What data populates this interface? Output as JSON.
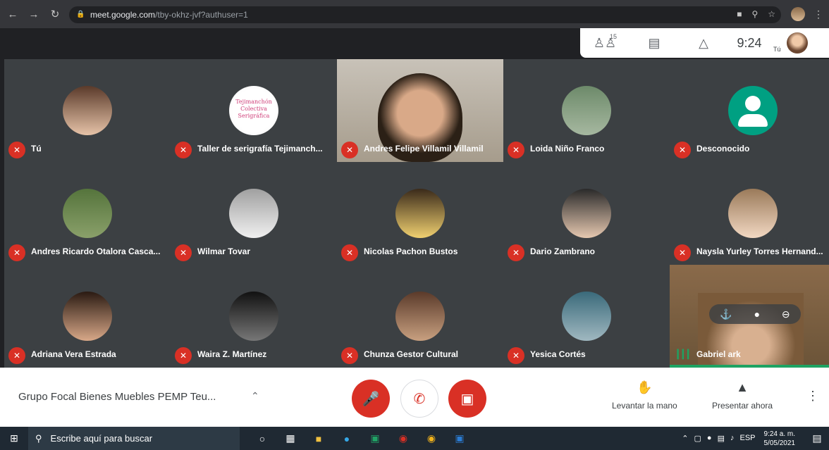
{
  "browser": {
    "url_host": "meet.google.com",
    "url_path": "/tby-okhz-jvf?authuser=1"
  },
  "meet_panel": {
    "participants_count": "15",
    "time": "9:24",
    "you_label": "Tú"
  },
  "tiles": [
    {
      "name": "Tú",
      "face": "linear-gradient(#5a3a2a,#e6c3a8)"
    },
    {
      "name": "Taller de serigrafía Tejimanch...",
      "face": "radial-gradient(circle,#ffffff 60%,#f2f2f2)",
      "logo_text": "Tejimanchón Colectiva Serigráfica"
    },
    {
      "name": "Andres Felipe Villamil Villamil",
      "face": "",
      "video": true
    },
    {
      "name": "Loida Niño Franco",
      "face": "linear-gradient(#6d8a6a,#a6b8a0)"
    },
    {
      "name": "Desconocido",
      "face": "#00a082",
      "generic": true
    },
    {
      "name": "Andres Ricardo Otalora Casca...",
      "face": "linear-gradient(#55743c,#8aa06a)"
    },
    {
      "name": "Wilmar Tovar",
      "face": "linear-gradient(#a0a0a0,#f0f0f0)"
    },
    {
      "name": "Nicolas Pachon Bustos",
      "face": "linear-gradient(#3a2a1a,#f0d070)"
    },
    {
      "name": "Dario Zambrano",
      "face": "linear-gradient(#2a2a2a,#e6c8b0)"
    },
    {
      "name": "Naysla Yurley Torres Hernand...",
      "face": "linear-gradient(#9a7a5a,#f2d8c2)"
    },
    {
      "name": "Adriana Vera Estrada",
      "face": "linear-gradient(#2a1a12,#d8a888)"
    },
    {
      "name": "Waira Z. Martínez",
      "face": "linear-gradient(#111111,#777777)"
    },
    {
      "name": "Chunza Gestor Cultural",
      "face": "linear-gradient(#5a3a2a,#c8a080)"
    },
    {
      "name": "Yesica Cortés",
      "face": "linear-gradient(#3a6a7a,#a0b8c0)"
    },
    {
      "name": "Gabriel ark",
      "face": "",
      "video2": true
    }
  ],
  "controls": {
    "meeting_title": "Grupo Focal Bienes Muebles PEMP Teu...",
    "raise_hand": "Levantar la mano",
    "present": "Presentar ahora"
  },
  "taskbar": {
    "search_placeholder": "Escribe aquí para buscar",
    "language": "ESP",
    "time": "9:24 a. m.",
    "date": "5/05/2021"
  },
  "colors": {
    "meet_red": "#d93025",
    "tile_bg": "#3c4043",
    "taskbar_bg": "#1f2933"
  }
}
